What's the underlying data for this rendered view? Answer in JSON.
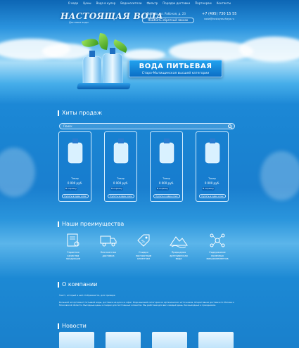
{
  "nav": [
    "О воде",
    "Цены",
    "Вода в кулер",
    "Водоносители",
    "Фильтр",
    "Порядок доставки",
    "Партнерам",
    "Контакты"
  ],
  "header": {
    "logo": "НАСТОЯЩАЯ ВОДА",
    "logo_sub": "Доставка воды",
    "address": "г. Москва, ул. Рабочая, д. 23",
    "callback": "Заказать обратный звонок",
    "phone": "+7 (495) 730 15 55",
    "email": "voda@nastoyaschaya.ru"
  },
  "hero": {
    "title": "ВОДА ПИТЬЕВАЯ",
    "subtitle": "Старо-Мытищинская высшей категории"
  },
  "hits": {
    "title": "Хиты продаж",
    "search_placeholder": "Поиск",
    "products": [
      {
        "name": "Товар",
        "price": "0 000 руб.",
        "buy": "В корзину",
        "oneclick": "Купить в один клик"
      },
      {
        "name": "Товар",
        "price": "0 000 руб.",
        "buy": "В корзину",
        "oneclick": "Купить в один клик"
      },
      {
        "name": "Товар",
        "price": "0 000 руб.",
        "buy": "В корзину",
        "oneclick": "Купить в один клик"
      },
      {
        "name": "Товар",
        "price": "0 000 руб.",
        "buy": "В корзину",
        "oneclick": "Купить в один клик"
      }
    ]
  },
  "advantages": {
    "title": "Наши преимущества",
    "items": [
      {
        "line1": "Гарантия",
        "line2": "качества",
        "line3": "продукции",
        "icon": "certificate-icon"
      },
      {
        "line1": "Бесплатная",
        "line2": "доставка",
        "line3": "",
        "icon": "truck-icon"
      },
      {
        "line1": "Скидки",
        "line2": "постоянным",
        "line3": "клиентам",
        "icon": "discount-tag-icon"
      },
      {
        "line1": "Природная",
        "line2": "артезианская",
        "line3": "вода",
        "icon": "mountain-icon"
      },
      {
        "line1": "Содержание",
        "line2": "полезных",
        "line3": "микроэлементов",
        "icon": "molecule-icon"
      }
    ]
  },
  "about": {
    "title": "О компании",
    "p1": "Текст, который в ней отображается, для примера",
    "p2": "Большой ассортимент питьевой воды, доставка на дом и в офис. Вода высшей категории из артезианских источников. Оперативная доставка по Москве и Московской области. Выгодные цены и скидки для постоянных клиентов. Мы работаем для вас каждый день, без выходных и праздников."
  },
  "news": {
    "title": "Новости"
  },
  "colors": {
    "primary": "#1a84d2",
    "accent": "#0a64b6",
    "leaf": "#6ec33a"
  }
}
